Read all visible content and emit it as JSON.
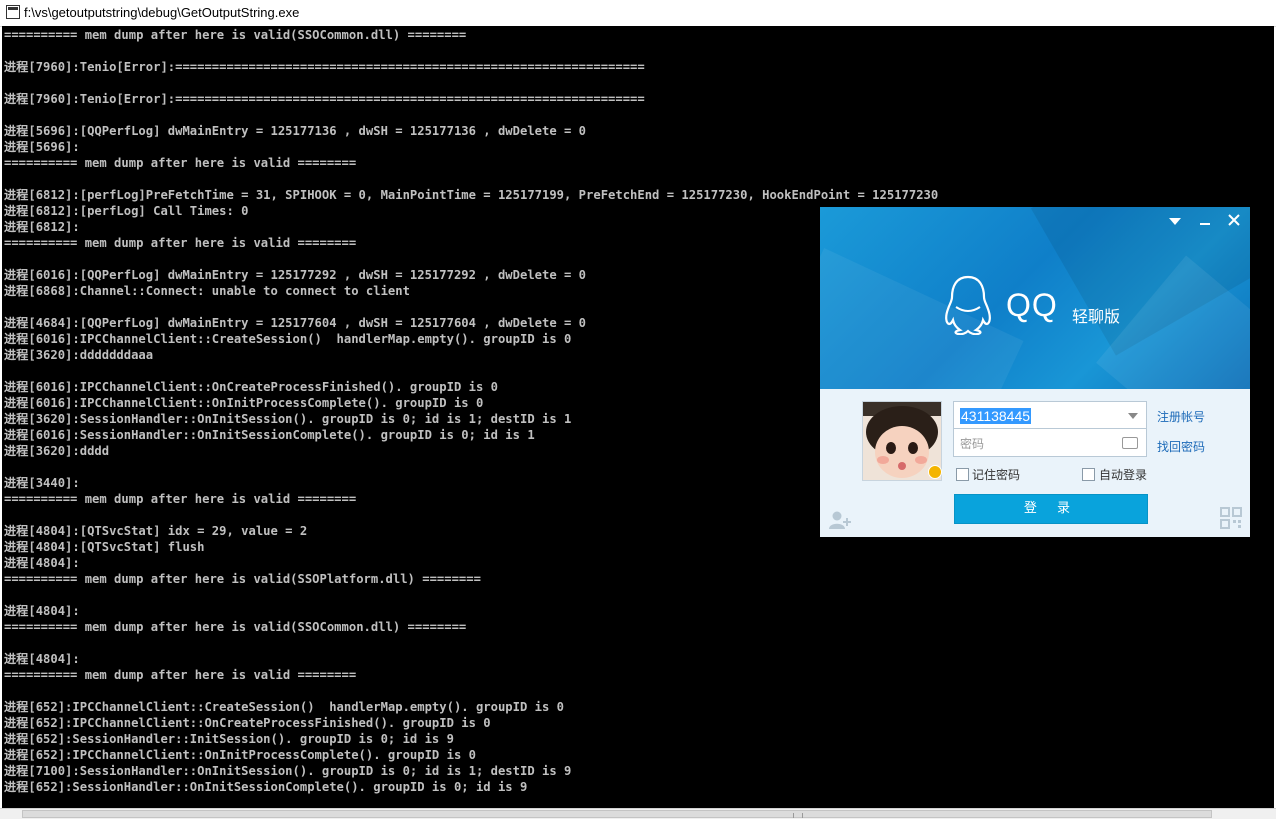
{
  "window": {
    "title": "f:\\vs\\getoutputstring\\debug\\GetOutputString.exe"
  },
  "console": {
    "lines": [
      "========== mem dump after here is valid(SSOCommon.dll) ========",
      "",
      "进程[7960]:Tenio[Error]:================================================================",
      "",
      "进程[7960]:Tenio[Error]:================================================================",
      "",
      "进程[5696]:[QQPerfLog] dwMainEntry = 125177136 , dwSH = 125177136 , dwDelete = 0",
      "进程[5696]:",
      "========== mem dump after here is valid ========",
      "",
      "进程[6812]:[perfLog]PreFetchTime = 31, SPIHOOK = 0, MainPointTime = 125177199, PreFetchEnd = 125177230, HookEndPoint = 125177230",
      "进程[6812]:[perfLog] Call Times: 0",
      "进程[6812]:",
      "========== mem dump after here is valid ========",
      "",
      "进程[6016]:[QQPerfLog] dwMainEntry = 125177292 , dwSH = 125177292 , dwDelete = 0",
      "进程[6868]:Channel::Connect: unable to connect to client",
      "",
      "进程[4684]:[QQPerfLog] dwMainEntry = 125177604 , dwSH = 125177604 , dwDelete = 0",
      "进程[6016]:IPCChannelClient::CreateSession()  handlerMap.empty(). groupID is 0",
      "进程[3620]:dddddddaaa",
      "",
      "进程[6016]:IPCChannelClient::OnCreateProcessFinished(). groupID is 0",
      "进程[6016]:IPCChannelClient::OnInitProcessComplete(). groupID is 0",
      "进程[3620]:SessionHandler::OnInitSession(). groupID is 0; id is 1; destID is 1",
      "进程[6016]:SessionHandler::OnInitSessionComplete(). groupID is 0; id is 1",
      "进程[3620]:dddd",
      "",
      "进程[3440]:",
      "========== mem dump after here is valid ========",
      "",
      "进程[4804]:[QTSvcStat] idx = 29, value = 2",
      "进程[4804]:[QTSvcStat] flush",
      "进程[4804]:",
      "========== mem dump after here is valid(SSOPlatform.dll) ========",
      "",
      "进程[4804]:",
      "========== mem dump after here is valid(SSOCommon.dll) ========",
      "",
      "进程[4804]:",
      "========== mem dump after here is valid ========",
      "",
      "进程[652]:IPCChannelClient::CreateSession()  handlerMap.empty(). groupID is 0",
      "进程[652]:IPCChannelClient::OnCreateProcessFinished(). groupID is 0",
      "进程[652]:SessionHandler::InitSession(). groupID is 0; id is 9",
      "进程[652]:IPCChannelClient::OnInitProcessComplete(). groupID is 0",
      "进程[7100]:SessionHandler::OnInitSession(). groupID is 0; id is 1; destID is 9",
      "进程[652]:SessionHandler::OnInitSessionComplete(). groupID is 0; id is 9"
    ]
  },
  "qq_login": {
    "brand": "QQ",
    "brand_sub": "轻聊版",
    "account_value": "431138445",
    "password_placeholder": "密码",
    "register_link": "注册帐号",
    "recover_link": "找回密码",
    "remember_password": "记住密码",
    "auto_login": "自动登录",
    "login_button": "登 录",
    "colors": {
      "banner": "#1296d6",
      "button": "#09a3dc",
      "link": "#1c6ab8",
      "status": "#f4b400"
    }
  }
}
